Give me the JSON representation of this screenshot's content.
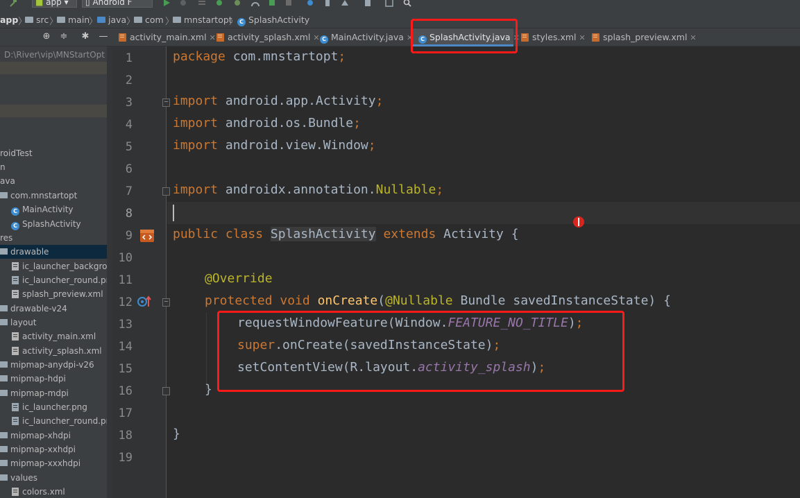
{
  "toolbar": {
    "module": "app",
    "device": "Android F"
  },
  "breadcrumb": [
    "app",
    "src",
    "main",
    "java",
    "com",
    "mnstartopt",
    "SplashActivity"
  ],
  "project_panel": {
    "path": "D:\\River\\vip\\MNStartOpt"
  },
  "tabs": [
    {
      "label": "activity_main.xml",
      "type": "xml"
    },
    {
      "label": "activity_splash.xml",
      "type": "xml"
    },
    {
      "label": "MainActivity.java",
      "type": "java"
    },
    {
      "label": "SplashActivity.java",
      "type": "java",
      "active": true
    },
    {
      "label": "styles.xml",
      "type": "xml"
    },
    {
      "label": "splash_preview.xml",
      "type": "xml"
    }
  ],
  "tree": [
    {
      "label": "roidTest"
    },
    {
      "label": "n"
    },
    {
      "label": "ava"
    },
    {
      "label": "com.mnstartopt"
    },
    {
      "label": "MainActivity"
    },
    {
      "label": "SplashActivity"
    },
    {
      "label": "res"
    },
    {
      "label": "drawable"
    },
    {
      "label": "ic_launcher_background"
    },
    {
      "label": "ic_launcher_round.png"
    },
    {
      "label": "splash_preview.xml"
    },
    {
      "label": "drawable-v24"
    },
    {
      "label": "layout"
    },
    {
      "label": "activity_main.xml"
    },
    {
      "label": "activity_splash.xml"
    },
    {
      "label": "mipmap-anydpi-v26"
    },
    {
      "label": "mipmap-hdpi"
    },
    {
      "label": "mipmap-mdpi"
    },
    {
      "label": "ic_launcher.png"
    },
    {
      "label": "ic_launcher_round.png"
    },
    {
      "label": "mipmap-xhdpi"
    },
    {
      "label": "mipmap-xxhdpi"
    },
    {
      "label": "mipmap-xxxhdpi"
    },
    {
      "label": "values"
    },
    {
      "label": "colors.xml"
    }
  ],
  "line_numbers": [
    "1",
    "2",
    "3",
    "4",
    "5",
    "6",
    "7",
    "8",
    "9",
    "10",
    "11",
    "12",
    "13",
    "14",
    "15",
    "16",
    "17",
    "18",
    "19"
  ],
  "code": {
    "l1_kw": "package",
    "l1_rest": " com.mnstartopt",
    "l1_semi": ";",
    "l3_kw": "import",
    "l3_rest": " android.app.Activity",
    "l3_semi": ";",
    "l4_kw": "import",
    "l4_rest": " android.os.Bundle",
    "l4_semi": ";",
    "l5_kw": "import",
    "l5_rest": " android.view.Window",
    "l5_semi": ";",
    "l7_kw": "import",
    "l7_a": " androidx.annotation.",
    "l7_ann": "Nullable",
    "l7_semi": ";",
    "l9_kw1": "public class ",
    "l9_cls": "SplashActivity",
    "l9_kw2": " extends ",
    "l9_rest": "Activity {",
    "l11_ann": "@Override",
    "l12_kw": "protected void ",
    "l12_fn": "onCreate",
    "l12_p1": "(",
    "l12_ann": "@Nullable",
    "l12_p2": " Bundle savedInstanceState) {",
    "l13_a": "requestWindowFeature(Window.",
    "l13_st": "FEATURE_NO_TITLE",
    "l13_b": ")",
    "l13_semi": ";",
    "l14_kw": "super",
    "l14_rest": ".onCreate(savedInstanceState)",
    "l14_semi": ";",
    "l15_a": "setContentView(R.layout.",
    "l15_st": "activity_splash",
    "l15_b": ")",
    "l15_semi": ";",
    "l16": "}",
    "l18": "}"
  },
  "colors": {
    "keyword": "#cc7832",
    "annotation": "#bbb529",
    "method": "#ffc66d",
    "static_field": "#9876aa",
    "highlight_box": "#ff1a1a"
  }
}
